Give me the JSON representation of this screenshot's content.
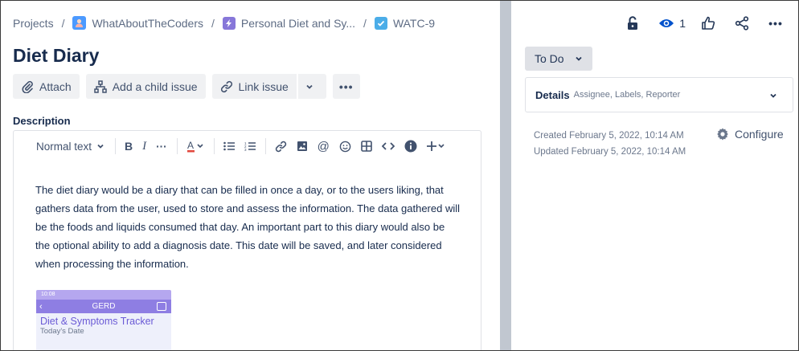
{
  "breadcrumb": {
    "projects": "Projects",
    "project": "WhatAboutTheCoders",
    "epic": "Personal Diet and Sy...",
    "issue_key": "WATC-9",
    "separator": "/"
  },
  "issue": {
    "title": "Diet Diary"
  },
  "toolbar": {
    "attach": "Attach",
    "add_child": "Add a child issue",
    "link_issue": "Link issue",
    "more": "•••"
  },
  "description": {
    "label": "Description",
    "text_style": "Normal text",
    "body": "The diet diary would be a diary that can be filled in once a day, or to the users liking, that gathers data from the user, used to store and assess the information. The data gathered will be the foods and liquids consumed that day. An important part to this diary would also be the optional ability to add a diagnosis date. This date will be saved, and later considered when processing the information."
  },
  "preview_image": {
    "status_time": "10:08",
    "bar_title": "GERD",
    "heading": "Diet & Symptoms Tracker",
    "subheading": "Today's Date"
  },
  "header_actions": {
    "watch_count": "1",
    "more": "•••"
  },
  "status": {
    "label": "To Do"
  },
  "details": {
    "title": "Details",
    "subtitle": "Assignee, Labels, Reporter"
  },
  "meta": {
    "created": "Created February 5, 2022, 10:14 AM",
    "updated": "Updated February 5, 2022, 10:14 AM",
    "configure": "Configure"
  },
  "colors": {
    "accent": "#0052cc",
    "splitter": "#c1c7d0",
    "button_bg": "#f0f1f3"
  }
}
